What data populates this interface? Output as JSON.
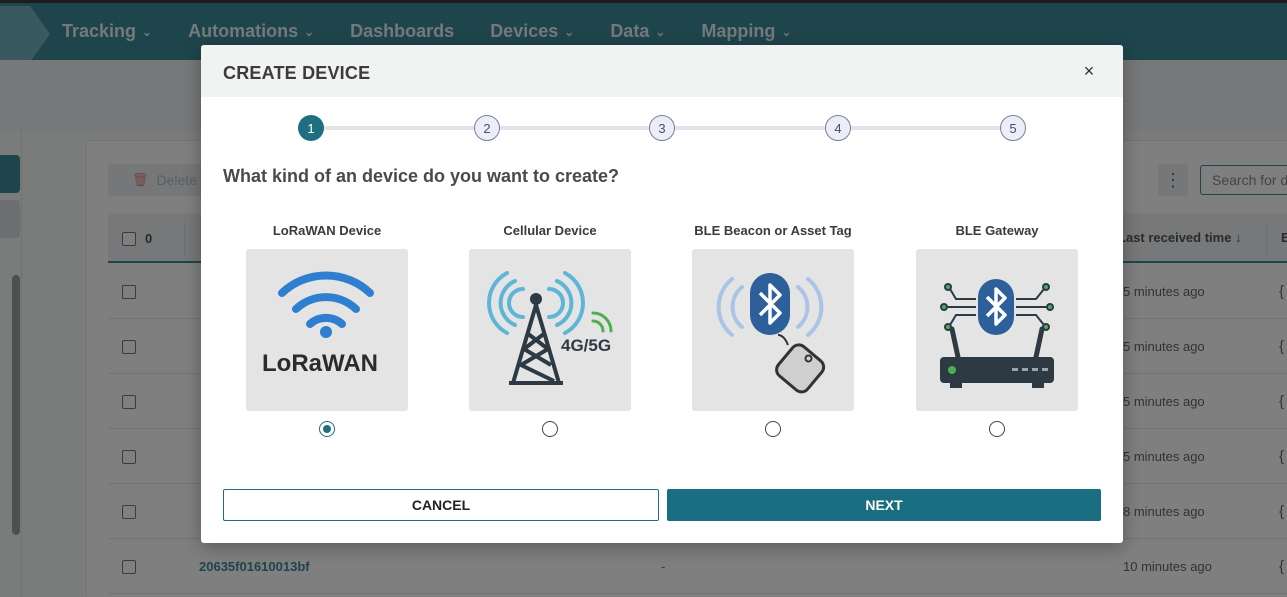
{
  "navbar": {
    "items": [
      {
        "label": "Tracking",
        "has_dropdown": true
      },
      {
        "label": "Automations",
        "has_dropdown": true
      },
      {
        "label": "Dashboards",
        "has_dropdown": false
      },
      {
        "label": "Devices",
        "has_dropdown": true
      },
      {
        "label": "Data",
        "has_dropdown": true
      },
      {
        "label": "Mapping",
        "has_dropdown": true
      }
    ],
    "chevron": "⌄"
  },
  "toolbar": {
    "delete_label": "Delete d",
    "search_placeholder": "Search for d"
  },
  "table": {
    "select_count": "0",
    "last_received_header": "Last received time ↓",
    "next_header_initial": "E",
    "rows": [
      {
        "id": "",
        "value": "",
        "time": "5 minutes ago"
      },
      {
        "id": "",
        "value": "",
        "time": "5 minutes ago"
      },
      {
        "id": "",
        "value": "",
        "time": "5 minutes ago"
      },
      {
        "id": "",
        "value": "",
        "time": "5 minutes ago"
      },
      {
        "id": "",
        "value": "",
        "time": "8 minutes ago"
      },
      {
        "id": "20635f01610013bf",
        "value": "-",
        "time": "10 minutes ago"
      }
    ]
  },
  "modal": {
    "title": "CREATE DEVICE",
    "close_glyph": "×",
    "question": "What kind of an device do you want to create?",
    "steps": [
      {
        "number": "1",
        "active": true
      },
      {
        "number": "2",
        "active": false
      },
      {
        "number": "3",
        "active": false
      },
      {
        "number": "4",
        "active": false
      },
      {
        "number": "5",
        "active": false
      }
    ],
    "options": [
      {
        "label": "LoRaWAN Device",
        "icon": "lorawan-icon",
        "logo_text": "LoRaWAN",
        "selected": true
      },
      {
        "label": "Cellular Device",
        "icon": "cell-tower-icon",
        "badge_text": "4G/5G",
        "selected": false
      },
      {
        "label": "BLE Beacon or Asset Tag",
        "icon": "ble-beacon-icon",
        "selected": false
      },
      {
        "label": "BLE Gateway",
        "icon": "ble-gateway-icon",
        "selected": false
      }
    ],
    "cancel_label": "CANCEL",
    "next_label": "NEXT"
  },
  "colors": {
    "nav_bg": "#3e8a98",
    "primary": "#1f6f82",
    "bluetooth_blue": "#2d5f9a",
    "wifi_blue": "#2f7fd0"
  }
}
